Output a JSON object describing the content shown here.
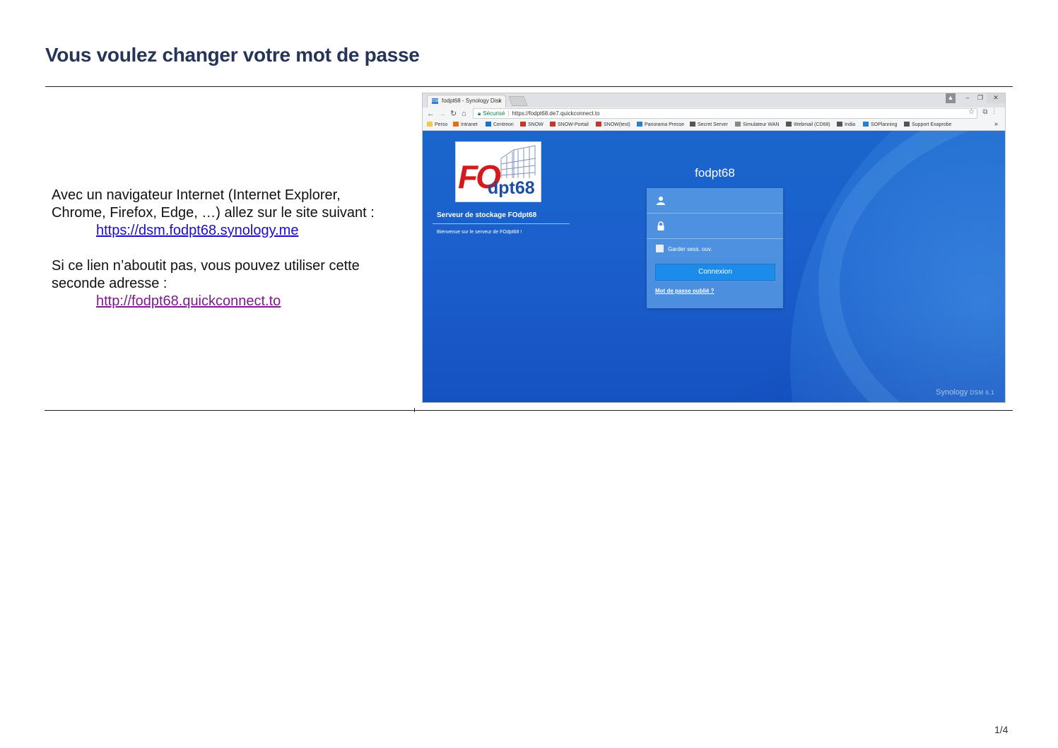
{
  "document": {
    "title": "Vous voulez changer votre mot de passe",
    "instructions_line1": "Avec un navigateur Internet (Internet Explorer,",
    "instructions_line2": "Chrome, Firefox, Edge, …) allez sur le site suivant :",
    "primary_link": "https://dsm.fodpt68.synology.me",
    "fallback_line1": "Si ce lien n’aboutit pas, vous pouvez utiliser cette",
    "fallback_line2": "seconde adresse :",
    "fallback_link": "http://fodpt68.quickconnect.to",
    "page_number": "1/4"
  },
  "browser": {
    "tab_title": "fodpt68 - Synology Disk",
    "tab_favicon": "DSM",
    "secure_label": "Sécurisé",
    "url": "https://fodpt68.de7.quickconnect.to",
    "bookmarks": [
      {
        "label": "Perso",
        "icon": "folder-icon",
        "color": "#f2c94c"
      },
      {
        "label": "Intranet",
        "icon": "intranet-icon",
        "color": "#e0701b"
      },
      {
        "label": "Centreon",
        "icon": "centreon-icon",
        "color": "#1a73c9"
      },
      {
        "label": "SNOW",
        "icon": "snow-icon",
        "color": "#c0392b"
      },
      {
        "label": "SNOW-Portail",
        "icon": "snow-icon",
        "color": "#c0392b"
      },
      {
        "label": "SNOW(test)",
        "icon": "snow-icon",
        "color": "#c0392b"
      },
      {
        "label": "Panorama Presse",
        "icon": "panorama-icon",
        "color": "#2b7bd1"
      },
      {
        "label": "Secret Server",
        "icon": "secret-server-icon",
        "color": "#555555"
      },
      {
        "label": "Simulateur WAN",
        "icon": "page-icon",
        "color": "#888888"
      },
      {
        "label": "Webmail (CD68)",
        "icon": "webmail-icon",
        "color": "#555555"
      },
      {
        "label": "India",
        "icon": "chart-icon",
        "color": "#555555"
      },
      {
        "label": "SOPlanning",
        "icon": "planning-icon",
        "color": "#2b7bd1"
      },
      {
        "label": "Support Exaprobe",
        "icon": "gear-icon",
        "color": "#555555"
      }
    ],
    "bookmarks_more": "»"
  },
  "dsm": {
    "logo_fo": "FO",
    "logo_dpt": "dpt68",
    "welcome_title": "Serveur de stockage FOdpt68",
    "welcome_text": "Bienvenue sur le serveur de FOdpt68 !",
    "server_name": "fodpt68",
    "remember_label": "Garder sess. ouv.",
    "login_button": "Connexion",
    "forgot_link": "Mot de passe oublié ?",
    "brand": "Synology",
    "version": "DSM 6.1"
  },
  "colors": {
    "title": "#243558",
    "link_primary": "#1a0dcc",
    "link_secondary": "#7b1a8a",
    "desktop_blue": "#1a66cc",
    "button_blue": "#1c8cea"
  }
}
